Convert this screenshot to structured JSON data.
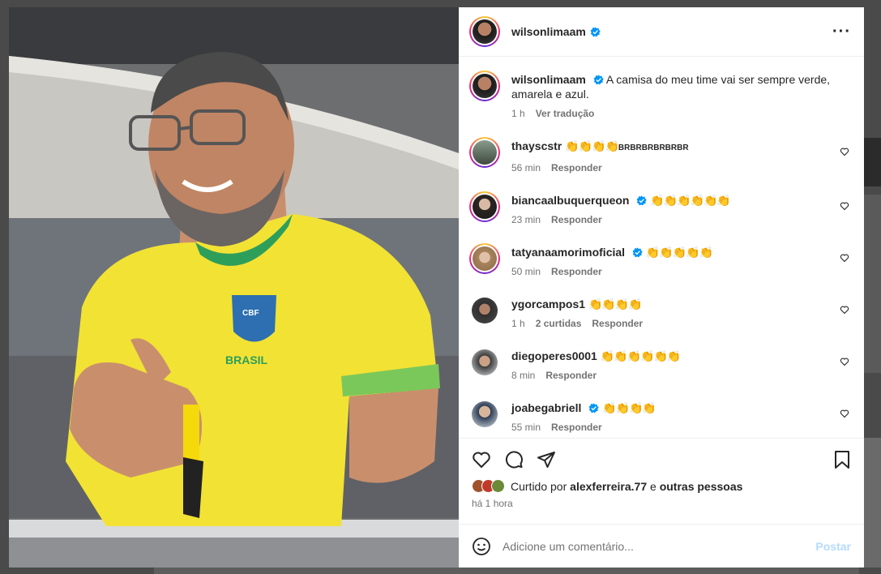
{
  "post": {
    "author": "wilsonlimaam",
    "caption": "A camisa do meu time vai ser sempre verde, amarela e azul.",
    "caption_time": "1 h",
    "translate_label": "Ver tradução"
  },
  "comments": [
    {
      "user": "thayscstr",
      "verified": false,
      "text": "👏👏👏👏",
      "extra": "BRBRBRBRBRBR",
      "time": "56 min",
      "likes": "",
      "reply": "Responder"
    },
    {
      "user": "biancaalbuquerqueon",
      "verified": true,
      "text": "👏👏👏👏👏👏",
      "extra": "",
      "time": "23 min",
      "likes": "",
      "reply": "Responder"
    },
    {
      "user": "tatyanaamorimoficial",
      "verified": true,
      "text": "👏👏👏👏👏",
      "extra": "",
      "time": "50 min",
      "likes": "",
      "reply": "Responder"
    },
    {
      "user": "ygorcampos1",
      "verified": false,
      "text": "👏👏👏👏",
      "extra": "",
      "time": "1 h",
      "likes": "2 curtidas",
      "reply": "Responder"
    },
    {
      "user": "diegoperes0001",
      "verified": false,
      "text": "👏👏👏👏👏👏",
      "extra": "",
      "time": "8 min",
      "likes": "",
      "reply": "Responder"
    },
    {
      "user": "joabegabriell",
      "verified": true,
      "text": "👏👏👏👏",
      "extra": "",
      "time": "55 min",
      "likes": "",
      "reply": "Responder"
    }
  ],
  "likes": {
    "prefix": "Curtido por",
    "user": "alexferreira.77",
    "connector": "e",
    "others": "outras pessoas",
    "time": "há 1 hora"
  },
  "add_comment": {
    "placeholder": "Adicione um comentário...",
    "post_label": "Postar"
  },
  "photo": {
    "shirt_text": "BRASIL",
    "badge_text": "CBF"
  },
  "colors": {
    "verified": "#0095f6",
    "post_disabled": "#b3dbff",
    "shirt": "#f2e234",
    "shirt_trim": "#2e9e5b"
  }
}
